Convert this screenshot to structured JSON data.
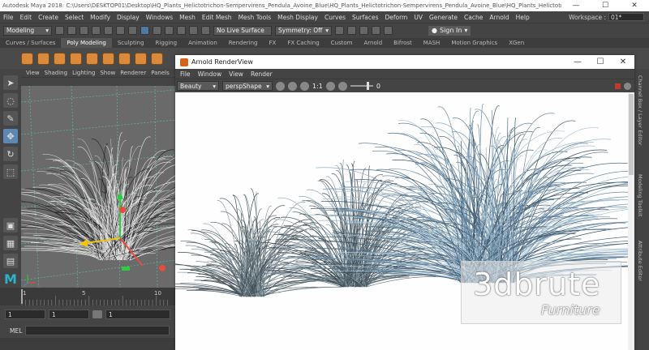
{
  "window": {
    "title": "Autodesk Maya 2018: C:\\Users\\DESKTOP01\\Desktop\\HQ_Plants_Helictotrichon-Sempervirens_Pendula_Avoine_Blue\\HQ_Plants_Helictotrichon-Sempervirens_Pendula_Avoine_Blue\\HQ_Plants_Helictotrichon-Sempervirens_Pendu...",
    "minimize": "—",
    "maximize": "☐",
    "close": "✕"
  },
  "menubar": {
    "items": [
      "File",
      "Edit",
      "Create",
      "Select",
      "Modify",
      "Display",
      "Windows",
      "Mesh",
      "Edit Mesh",
      "Mesh Tools",
      "Mesh Display",
      "Curves",
      "Surfaces",
      "Deform",
      "UV",
      "Generate",
      "Cache",
      "Arnold",
      "Help"
    ],
    "workspace_label": "Workspace :",
    "workspace_value": "01*"
  },
  "statusline": {
    "mode": "Modeling",
    "live_surface": "No Live Surface",
    "symmetry": "Symmetry: Off",
    "sign_in": "Sign In"
  },
  "shelf": {
    "tabs": [
      "Curves / Surfaces",
      "Poly Modeling",
      "Sculpting",
      "Rigging",
      "Animation",
      "Rendering",
      "FX",
      "FX Caching",
      "Custom",
      "Arnold",
      "Bifrost",
      "MASH",
      "Motion Graphics",
      "XGen"
    ],
    "active_tab": "Poly Modeling"
  },
  "viewport": {
    "menu": [
      "View",
      "Shading",
      "Lighting",
      "Show",
      "Renderer",
      "Panels"
    ]
  },
  "timeline": {
    "tick_labels": [
      "1",
      "5",
      "10"
    ],
    "range_start": "1",
    "range_inner": "1",
    "range_field": "1"
  },
  "mel": {
    "label": "MEL"
  },
  "right_tabs": [
    "Channel Box / Layer Editor",
    "Modeling Toolkit",
    "Attribute Editor"
  ],
  "renderview": {
    "title": "Arnold RenderView",
    "menu": [
      "File",
      "Window",
      "View",
      "Render"
    ],
    "aov": "Beauty",
    "camera": "perspShape",
    "ratio": "1:1",
    "exposure": "0",
    "min": "—",
    "max": "☐",
    "close": "✕"
  },
  "watermark": {
    "brand": "3dbrute",
    "sub": "Furniture"
  },
  "colors": {
    "maya_logo": "#2fb2c7",
    "grass_blue": "#6f8ea6",
    "grass_dark": "#4f5e66",
    "stop": "#c0392b"
  }
}
